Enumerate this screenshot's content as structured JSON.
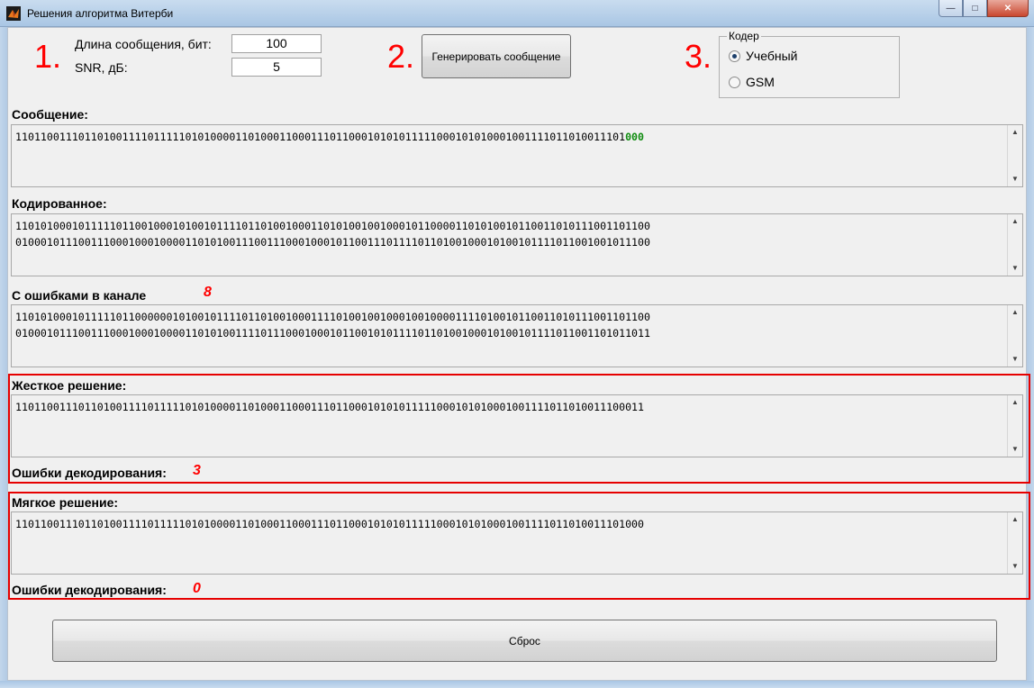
{
  "window": {
    "title": "Решения алгоритма Витерби",
    "min": "—",
    "max": "□",
    "close": "✕"
  },
  "step1": {
    "number": "1.",
    "length_label": "Длина сообщения, бит:",
    "length_value": "100",
    "snr_label": "SNR, дБ:",
    "snr_value": "5"
  },
  "step2": {
    "number": "2.",
    "button": "Генерировать сообщение"
  },
  "step3": {
    "number": "3.",
    "group_title": "Кодер",
    "options": [
      {
        "label": "Учебный",
        "selected": true
      },
      {
        "label": "GSM",
        "selected": false
      }
    ]
  },
  "message": {
    "label": "Сообщение:",
    "line1": "1101100111011010011110111110101000011010001100011101100010101011111000101010001001111011010011101",
    "tail": "000"
  },
  "encoded": {
    "label": "Кодированное:",
    "line1": "11010100010111110110010001010010111101101001000110101001001000101100001101010010110011010111001101100",
    "line2": "01000101110011100010001000011010100111001110001000101100111011110110100100010100101111011001001011100"
  },
  "channel": {
    "label": "С ошибками в канале",
    "error_count": "8",
    "line1": "11010100010111110110000001010010111101101001000111101001001000100100001111010010110011010111001101100",
    "line2": "01000101110011100010001000011010100111101110001000101100101011110110100100010100101111011001101011011"
  },
  "hard": {
    "label": "Жесткое решение:",
    "line1": "1101100111011010011110111110101000011010001100011101100010101011111000101010001001111011010011100011",
    "errors_label": "Ошибки декодирования:",
    "errors_value": "3"
  },
  "soft": {
    "label": "Мягкое решение:",
    "line1": "1101100111011010011110111110101000011010001100011101100010101011111000101010001001111011010011101000",
    "errors_label": "Ошибки декодирования:",
    "errors_value": "0"
  },
  "reset_button": "Сброс",
  "colors": {
    "step_red": "#ff0000",
    "highlight_blue": "#1010e0",
    "highlight_green": "#108c10",
    "frame_red": "#e60000"
  }
}
